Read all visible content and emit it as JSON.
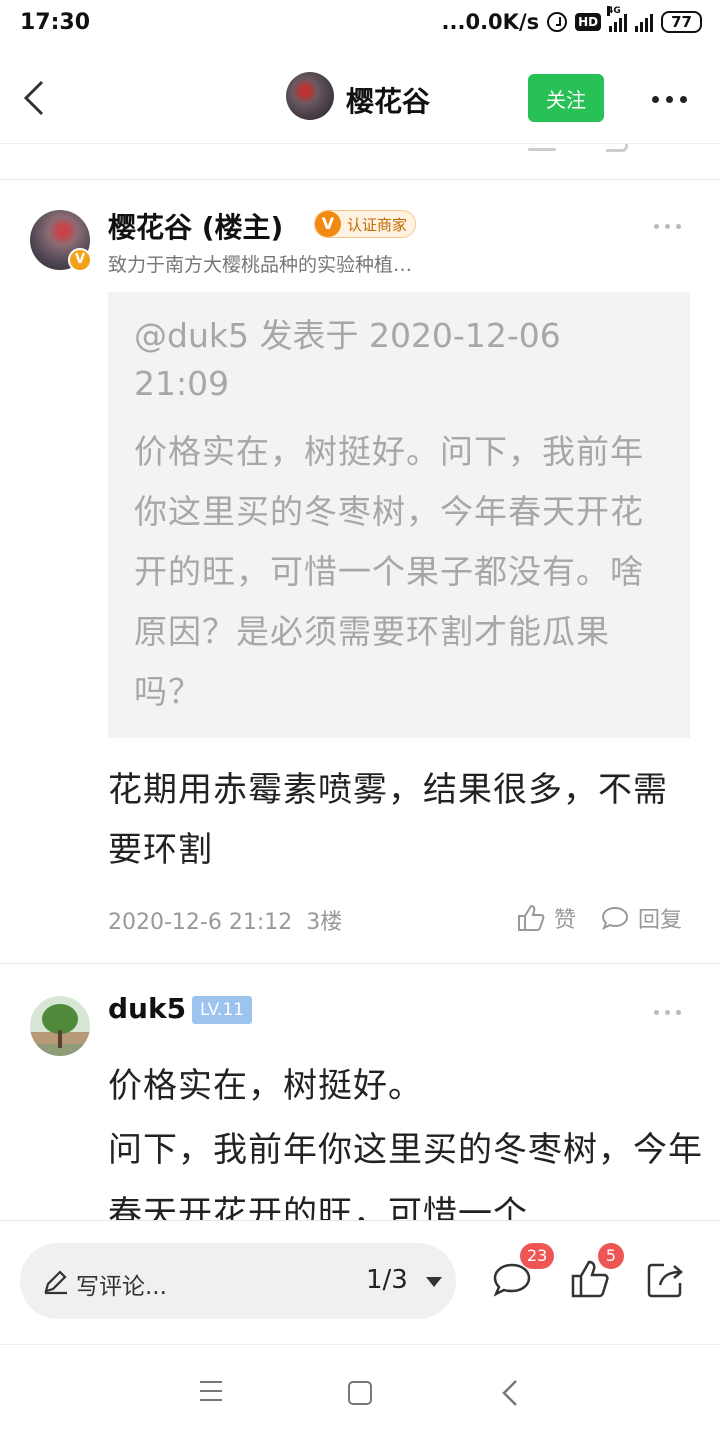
{
  "status_bar": {
    "time": "17:30",
    "net_speed": "...0.0K/s",
    "hd": "HD",
    "network": "4G",
    "battery": "77"
  },
  "nav": {
    "title": "樱花谷",
    "follow_label": "关注"
  },
  "post1": {
    "author": "樱花谷 (楼主)",
    "badge_letter": "V",
    "badge_label": "认证商家",
    "author_desc": "致力于南方大樱桃品种的实验种植…",
    "quote_meta": "@duk5 发表于 2020-12-06 21:09",
    "quote_text": "价格实在，树挺好。问下，我前年你这里买的冬枣树，今年春天开花开的旺，可惜一个果子都没有。啥原因？是必须需要环割才能瓜果吗？",
    "reply_text": "花期用赤霉素喷雾，结果很多，不需要环割",
    "timestamp": "2020-12-6 21:12",
    "floor": "3楼",
    "like_label": "赞",
    "reply_label": "回复"
  },
  "post2": {
    "author": "duk5",
    "level": "LV.11",
    "text": "价格实在，树挺好。\n问下，我前年你这里买的冬枣树，今年春天开花开的旺，可惜一个"
  },
  "comment_bar": {
    "placeholder": "写评论...",
    "page": "1/3",
    "comment_count": "23",
    "like_count": "5"
  },
  "colors": {
    "accent_green": "#27c155",
    "badge_red": "#ee5555",
    "merchant_orange": "#f08a12",
    "level_blue": "#9cc4ee"
  },
  "icons": [
    "back-icon",
    "more-icon",
    "verified-icon",
    "like-icon",
    "reply-icon",
    "pen-icon",
    "comment-icon",
    "thumb-icon",
    "share-icon",
    "menu-icon",
    "home-icon",
    "back-nav-icon"
  ]
}
